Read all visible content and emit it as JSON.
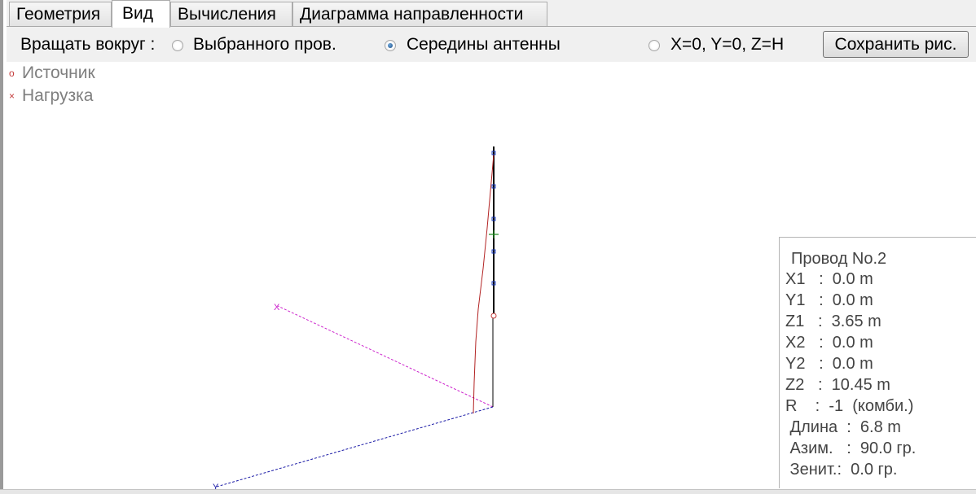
{
  "tabs": [
    {
      "label": "Геометрия"
    },
    {
      "label": "Вид"
    },
    {
      "label": "Вычисления"
    },
    {
      "label": "Диаграмма направленности"
    }
  ],
  "active_tab": "Вид",
  "toolbar": {
    "rotate_label": "Вращать вокруг :",
    "options": [
      {
        "label": "Выбранного пров.",
        "checked": false
      },
      {
        "label": "Середины антенны",
        "checked": true
      },
      {
        "label": "X=0, Y=0, Z=H",
        "checked": false
      }
    ],
    "save_label": "Сохранить рис."
  },
  "legend": [
    {
      "symbol": "o",
      "label": "Источник"
    },
    {
      "symbol": "×",
      "label": "Нагрузка"
    }
  ],
  "axes": {
    "x_label": "X",
    "y_label": "Y"
  },
  "wire_info": {
    "title": "Провод No.2",
    "lines": [
      "X1   :  0.0 m",
      "Y1   :  0.0 m",
      "Z1   :  3.65 m",
      "X2   :  0.0 m",
      "Y2   :  0.0 m",
      "Z2   :  10.45 m",
      "R    :  -1  (комби.)",
      " Длина  :  6.8 m",
      " Азим.   :  90.0 гр.",
      " Зенит.:  0.0 гр."
    ]
  },
  "colors": {
    "wire": "#000000",
    "current": "#b22222",
    "segment_marker": "#1f3fbf",
    "axis_x": "#cc22cc",
    "axis_y": "#1a1aa6",
    "selected_marker": "#1a8a1a"
  }
}
